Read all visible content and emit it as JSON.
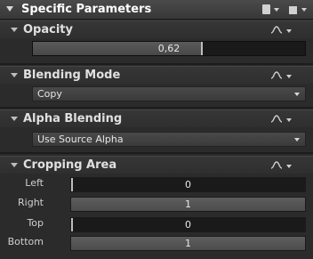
{
  "header": {
    "title": "Specific Parameters"
  },
  "opacity": {
    "title": "Opacity",
    "value_text": "0,62",
    "value": 0.62
  },
  "blending_mode": {
    "title": "Blending Mode",
    "selected": "Copy"
  },
  "alpha_blending": {
    "title": "Alpha Blending",
    "selected": "Use Source Alpha"
  },
  "cropping": {
    "title": "Cropping Area",
    "rows": [
      {
        "label": "Left",
        "value": "0",
        "style": "dark"
      },
      {
        "label": "Right",
        "value": "1",
        "style": "light"
      },
      {
        "label": "Top",
        "value": "0",
        "style": "dark"
      },
      {
        "label": "Bottom",
        "value": "1",
        "style": "light"
      }
    ]
  },
  "icons": {
    "header": [
      "page-icon",
      "dropdown-arrow-icon",
      "folder-icon",
      "dropdown-arrow-icon"
    ],
    "section": [
      "curve-icon",
      "dropdown-arrow-icon"
    ]
  }
}
